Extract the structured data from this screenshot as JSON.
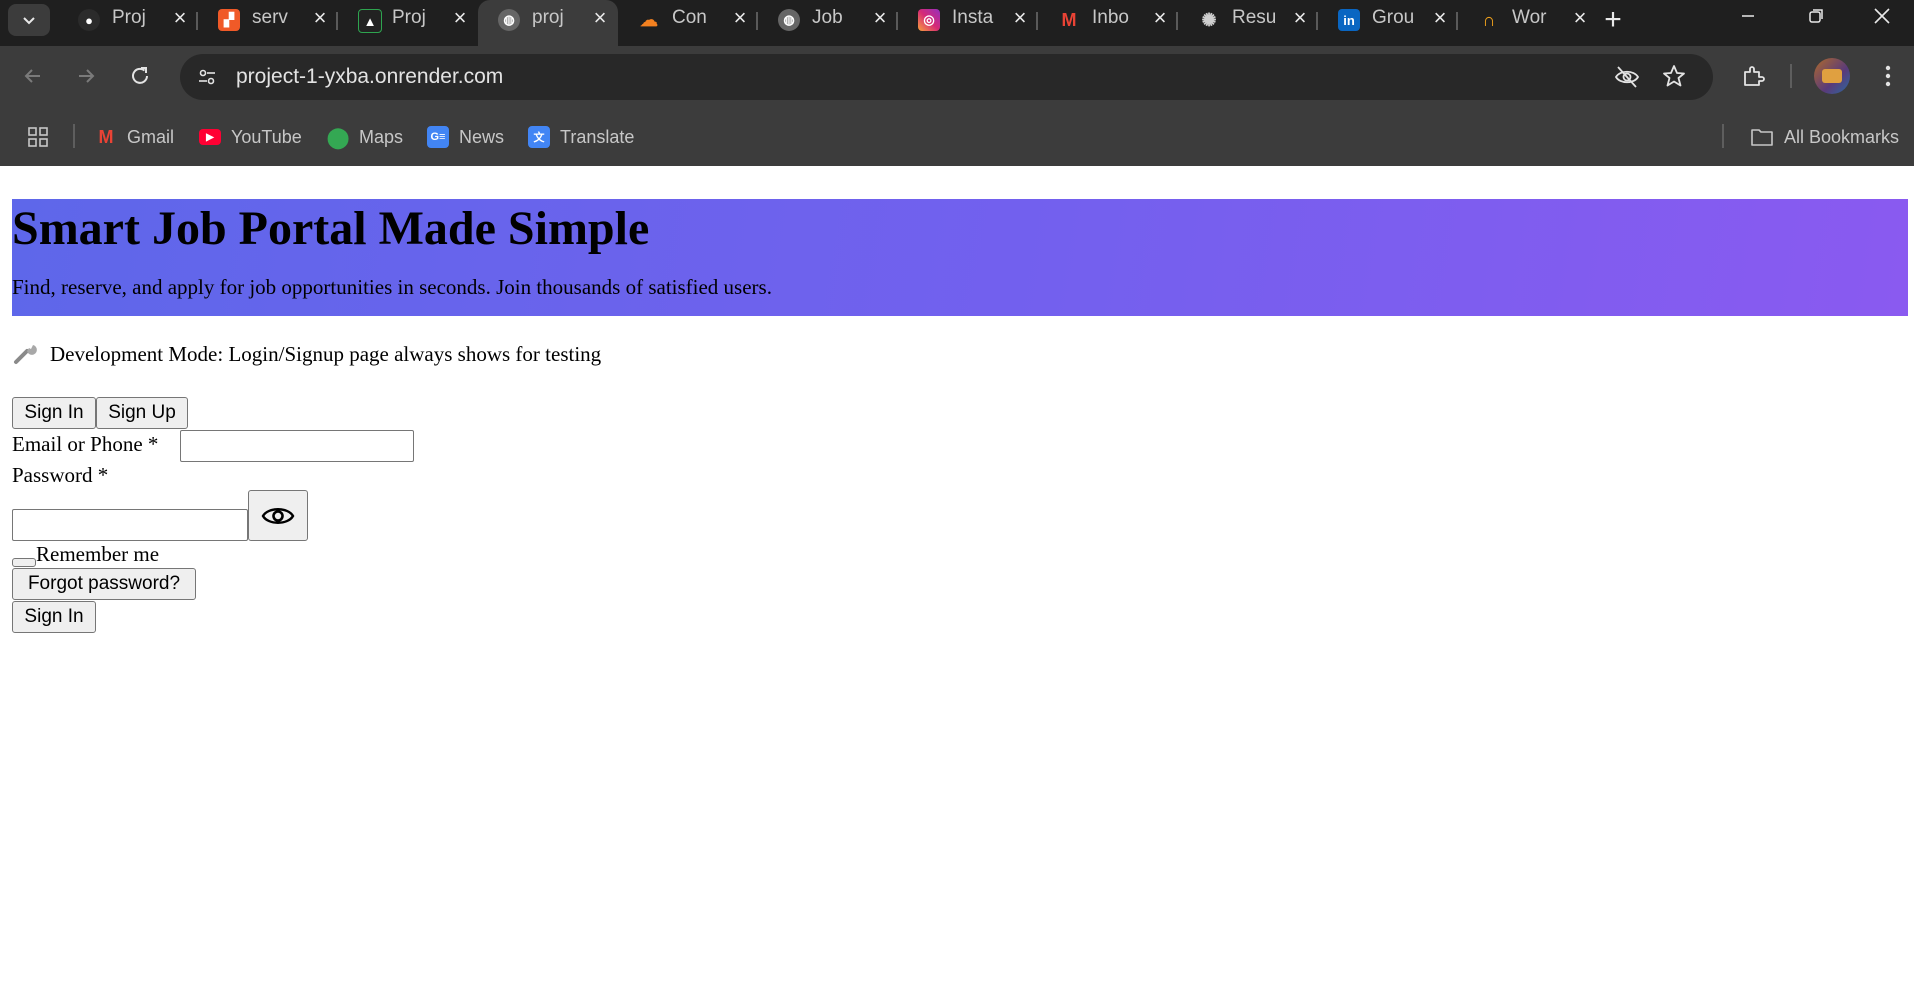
{
  "browser": {
    "tabs": [
      {
        "title": "Proj",
        "icon": "github-icon",
        "color": "#2b2b2b"
      },
      {
        "title": "serv",
        "icon": "render-icon",
        "color": "#f05a28"
      },
      {
        "title": "Proj",
        "icon": "vercel-icon",
        "color": "#222222"
      },
      {
        "title": "proj",
        "icon": "globe-icon",
        "color": "#777777",
        "active": true
      },
      {
        "title": "Con",
        "icon": "cloudflare-icon",
        "color": "#f48120"
      },
      {
        "title": "Job",
        "icon": "globe-icon",
        "color": "#777777"
      },
      {
        "title": "Insta",
        "icon": "instagram-icon",
        "color": "#d62976"
      },
      {
        "title": "Inbo",
        "icon": "gmail-icon",
        "color": "#ea4335"
      },
      {
        "title": "Resu",
        "icon": "openai-icon",
        "color": "#202020"
      },
      {
        "title": "Grou",
        "icon": "linkedin-icon",
        "color": "#0a66c2"
      },
      {
        "title": "Wor",
        "icon": "headset-icon",
        "color": "#1d86c8"
      }
    ],
    "url": "project-1-yxba.onrender.com",
    "bookmarks": [
      {
        "label": "Gmail",
        "icon": "gmail-icon",
        "color": "#ea4335"
      },
      {
        "label": "YouTube",
        "icon": "youtube-icon",
        "color": "#ff0033"
      },
      {
        "label": "Maps",
        "icon": "maps-icon",
        "color": "#34a853"
      },
      {
        "label": "News",
        "icon": "news-icon",
        "color": "#4285f4"
      },
      {
        "label": "Translate",
        "icon": "translate-icon",
        "color": "#4285f4"
      }
    ],
    "all_bookmarks": "All Bookmarks"
  },
  "page": {
    "hero": {
      "title": "Smart Job Portal Made Simple",
      "subtitle": "Find, reserve, and apply for job opportunities in seconds. Join thousands of satisfied users.",
      "gradient": [
        "#5e67ea",
        "#8a5af0"
      ]
    },
    "dev_note": "Development Mode: Login/Signup page always shows for testing",
    "auth_tabs": {
      "sign_in": "Sign In",
      "sign_up": "Sign Up"
    },
    "form": {
      "email_label": "Email or Phone *",
      "email_value": "",
      "password_label": "Password *",
      "password_value": "",
      "remember_label": "Remember me",
      "forgot_label": "Forgot password?",
      "submit_label": "Sign In"
    }
  }
}
